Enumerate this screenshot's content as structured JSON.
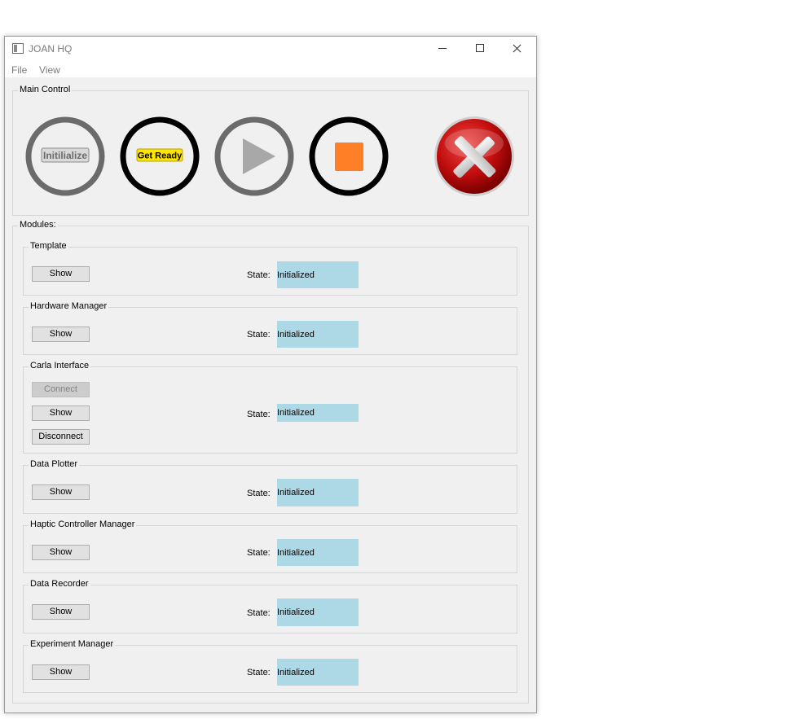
{
  "window": {
    "title": "JOAN HQ"
  },
  "menu": {
    "file": "File",
    "view": "View"
  },
  "main_control": {
    "title": "Main Control",
    "initialize_label": "Initilialize",
    "get_ready_label": "Get Ready",
    "colors": {
      "ring_dark": "#000000",
      "ring_grey": "#6b6b6b",
      "play": "#a8a8a8",
      "stop": "#ff7f27",
      "get_ready_bg": "#ffe500",
      "exit_red": "#c10d0d"
    }
  },
  "modules": {
    "title": "Modules:",
    "state_label": "State:",
    "state_color": "#add8e6",
    "items": [
      {
        "name": "Template",
        "show": "Show",
        "state": "Initialized"
      },
      {
        "name": "Hardware Manager",
        "show": "Show",
        "state": "Initialized"
      },
      {
        "name": "Carla Interface",
        "connect": "Connect",
        "show": "Show",
        "disconnect": "Disconnect",
        "state": "Initialized"
      },
      {
        "name": "Data Plotter",
        "show": "Show",
        "state": "Initialized"
      },
      {
        "name": "Haptic Controller Manager",
        "show": "Show",
        "state": "Initialized"
      },
      {
        "name": "Data Recorder",
        "show": "Show",
        "state": "Initialized"
      },
      {
        "name": "Experiment Manager",
        "show": "Show",
        "state": "Initialized"
      }
    ]
  }
}
